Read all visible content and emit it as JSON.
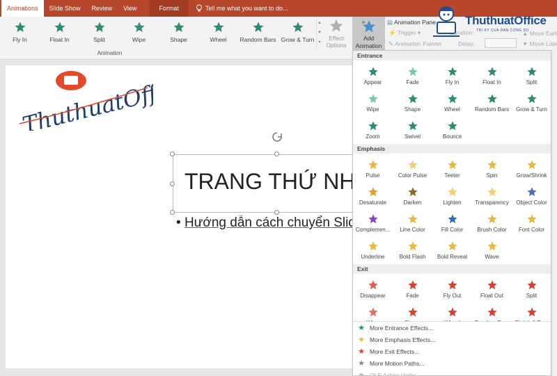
{
  "tabs": [
    "Animations",
    "Slide Show",
    "Review",
    "View",
    "Format"
  ],
  "tellme": "Tell me what you want to do...",
  "ribbon": {
    "gallery": [
      {
        "label": "Fly In",
        "color": "#2e8b74"
      },
      {
        "label": "Float In",
        "color": "#2e8b74"
      },
      {
        "label": "Split",
        "color": "#2e8b74"
      },
      {
        "label": "Wipe",
        "color": "#2e8b74"
      },
      {
        "label": "Shape",
        "color": "#2e8b74"
      },
      {
        "label": "Wheel",
        "color": "#2e8b74"
      },
      {
        "label": "Random Bars",
        "color": "#2e8b74"
      },
      {
        "label": "Grow & Turn",
        "color": "#2e8b74"
      }
    ],
    "group_label": "Animation",
    "effect_options": "Effect Options",
    "add_animation": "Add Animation",
    "animation_pane": "Animation Pane",
    "trigger": "Trigger",
    "animation_painter": "Animation Painter",
    "duration": "Duration:",
    "delay": "Delay:",
    "move_earlier": "Move Earli",
    "move_later": "Move Late"
  },
  "logo": {
    "brand": "ThuthuatOffice",
    "tagline": "TRI KY CUA DAN CONG SO",
    "script": "ThuthuatOffice"
  },
  "slide": {
    "title": "TRANG THỨ NHẤT",
    "bullet": "Hướng dẫn cách chuyển Slide"
  },
  "dropdown": {
    "sections": [
      {
        "name": "Entrance",
        "items": [
          {
            "label": "Appear",
            "color": "#2e8b74"
          },
          {
            "label": "Fade",
            "color": "#7fc4b0"
          },
          {
            "label": "Fly In",
            "color": "#2e8b74"
          },
          {
            "label": "Float In",
            "color": "#2e8b74"
          },
          {
            "label": "Split",
            "color": "#2e8b74"
          },
          {
            "label": "Wipe",
            "color": "#7fc4b0"
          },
          {
            "label": "Shape",
            "color": "#2e8b74"
          },
          {
            "label": "Wheel",
            "color": "#2e8b74"
          },
          {
            "label": "Random Bars",
            "color": "#2e8b74"
          },
          {
            "label": "Grow & Turn",
            "color": "#2e8b74"
          },
          {
            "label": "Zoom",
            "color": "#2e8b74"
          },
          {
            "label": "Swivel",
            "color": "#2e8b74"
          },
          {
            "label": "Bounce",
            "color": "#2e8b74"
          }
        ]
      },
      {
        "name": "Emphasis",
        "items": [
          {
            "label": "Pulse",
            "color": "#e8b840"
          },
          {
            "label": "Color Pulse",
            "color": "#f0d070"
          },
          {
            "label": "Teeter",
            "color": "#e8b840"
          },
          {
            "label": "Spin",
            "color": "#e8b840"
          },
          {
            "label": "Grow/Shrink",
            "color": "#e8b840"
          },
          {
            "label": "Desaturate",
            "color": "#d8a030"
          },
          {
            "label": "Darken",
            "color": "#8a6a20"
          },
          {
            "label": "Lighten",
            "color": "#f0d070"
          },
          {
            "label": "Transparency",
            "color": "#f0d070"
          },
          {
            "label": "Object Color",
            "color": "#4a6fc0"
          },
          {
            "label": "Complemen...",
            "color": "#9040c0"
          },
          {
            "label": "Line Color",
            "color": "#e8b840"
          },
          {
            "label": "Fill Color",
            "color": "#2a70c0"
          },
          {
            "label": "Brush Color",
            "color": "#e8b840"
          },
          {
            "label": "Font Color",
            "color": "#e8b840"
          },
          {
            "label": "Underline",
            "color": "#e8b840"
          },
          {
            "label": "Bold Flash",
            "color": "#e8b840"
          },
          {
            "label": "Bold Reveal",
            "color": "#e8b840"
          },
          {
            "label": "Wave",
            "color": "#e8b840"
          }
        ]
      },
      {
        "name": "Exit",
        "items": [
          {
            "label": "Disappear",
            "color": "#e06050"
          },
          {
            "label": "Fade",
            "color": "#d84030"
          },
          {
            "label": "Fly Out",
            "color": "#d84030"
          },
          {
            "label": "Float Out",
            "color": "#d84030"
          },
          {
            "label": "Split",
            "color": "#d84030"
          },
          {
            "label": "Wipe",
            "color": "#e07060"
          },
          {
            "label": "Shape",
            "color": "#d84030"
          },
          {
            "label": "Wheel",
            "color": "#d84030"
          },
          {
            "label": "Random Bars",
            "color": "#d84030"
          },
          {
            "label": "Shrink & Turn",
            "color": "#d84030"
          }
        ]
      }
    ],
    "more": [
      {
        "label": "More Entrance Effects...",
        "color": "#2e8b74",
        "disabled": false
      },
      {
        "label": "More Emphasis Effects...",
        "color": "#e8b840",
        "disabled": false
      },
      {
        "label": "More Exit Effects...",
        "color": "#d84030",
        "disabled": false
      },
      {
        "label": "More Motion Paths...",
        "color": "#888888",
        "disabled": false
      },
      {
        "label": "OLE Action Verbs...",
        "color": "#bbbbbb",
        "disabled": true
      }
    ]
  }
}
